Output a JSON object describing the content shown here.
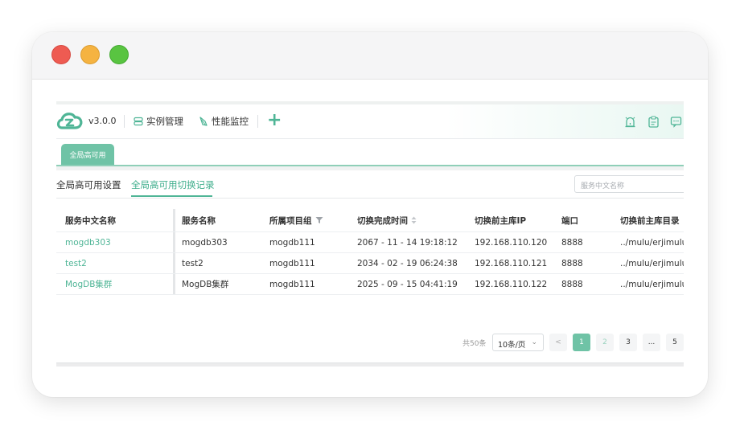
{
  "window": {
    "controls": [
      "close",
      "minimize",
      "maximize"
    ]
  },
  "topnav": {
    "version": "v3.0.0",
    "items": [
      {
        "label": "实例管理",
        "icon": "database-icon"
      },
      {
        "label": "性能监控",
        "icon": "leaf-icon"
      }
    ],
    "add_label": "+",
    "right_icons": [
      "alarm-icon",
      "clipboard-icon",
      "chat-icon"
    ]
  },
  "tabbar": {
    "active_tab": "全局高可用"
  },
  "subtabs": {
    "items": [
      "全局高可用设置",
      "全局高可用切换记录"
    ],
    "active": "全局高可用切换记录",
    "search_placeholder": "服务中文名称"
  },
  "table": {
    "headers": [
      "服务中文名称",
      "服务名称",
      "所属项目组",
      "切换完成时间",
      "切换前主库IP",
      "端口",
      "切换前主库目录"
    ],
    "rows": [
      [
        "mogdb303",
        "mogdb303",
        "mogdb111",
        "2067 - 11 - 14 19:18:12",
        "192.168.110.120",
        "8888",
        "../mulu/erjimulu"
      ],
      [
        "test2",
        "test2",
        "mogdb111",
        "2034 - 02 - 19 06:24:38",
        "192.168.110.121",
        "8888",
        "../mulu/erjimulu"
      ],
      [
        "MogDB集群",
        "MogDB集群",
        "mogdb111",
        "2025 - 09 - 15 04:41:19",
        "192.168.110.122",
        "8888",
        "../mulu/erjimulu"
      ]
    ]
  },
  "pagination": {
    "total": "共50条",
    "page_size": "10条/页",
    "prev": "<",
    "pages": [
      "1",
      "2",
      "3",
      "...",
      "5"
    ],
    "current": "1"
  },
  "colors": {
    "accent": "#4fb596",
    "tab_active": "#6fc3a6",
    "traffic_red": "#ee5b52",
    "traffic_yellow": "#f5b341",
    "traffic_green": "#59c441"
  }
}
